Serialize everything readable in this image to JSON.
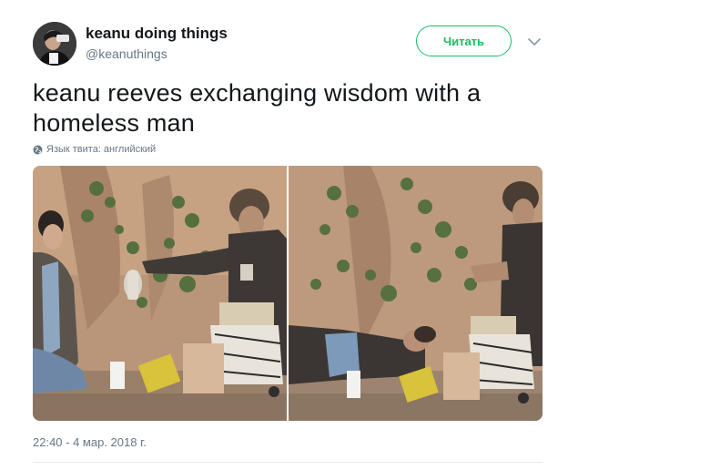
{
  "account": {
    "display_name": "keanu doing things",
    "handle": "@keanuthings",
    "avatar_icon": "profile-avatar"
  },
  "follow_button": {
    "label": "Читать",
    "color": "#17bf63"
  },
  "menu_icon": "chevron-down-icon",
  "tweet": {
    "text": "keanu reeves exchanging wisdom with a homeless man",
    "language_note": "Язык твита: английский",
    "language_icon": "globe-icon",
    "timestamp": "22:40 - 4 мар. 2018 г."
  },
  "media": {
    "photos": [
      {
        "name": "photo-1",
        "alt_icon": "photo"
      },
      {
        "name": "photo-2",
        "alt_icon": "photo"
      }
    ]
  },
  "colors": {
    "text": "#14171a",
    "secondary": "#657786",
    "accent": "#17bf63",
    "divider": "#e6ecf0"
  }
}
